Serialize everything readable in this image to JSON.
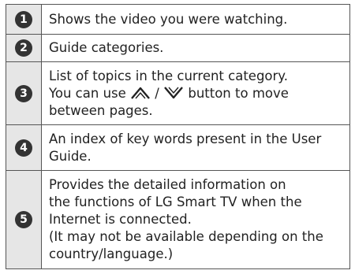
{
  "rows": [
    {
      "number": "1",
      "lines": [
        "Shows the video you were watching."
      ]
    },
    {
      "number": "2",
      "lines": [
        "Guide categories."
      ]
    },
    {
      "number": "3",
      "lines": [
        "List of topics in the current category.",
        "You can use",
        "/",
        "button to move",
        "between pages."
      ],
      "icons": [
        "up-arrow-icon",
        "down-arrow-icon"
      ]
    },
    {
      "number": "4",
      "lines": [
        "An index of key words present in the User",
        "Guide."
      ]
    },
    {
      "number": "5",
      "lines": [
        "Provides the detailed information on",
        "the functions of LG Smart TV when the",
        "Internet is connected.",
        "(It may not be available depending on the",
        "country/language.)"
      ]
    }
  ],
  "colors": {
    "number_cell_bg": "#e6e6e6",
    "badge_bg": "#333333",
    "border": "#555555",
    "text": "#222222"
  }
}
